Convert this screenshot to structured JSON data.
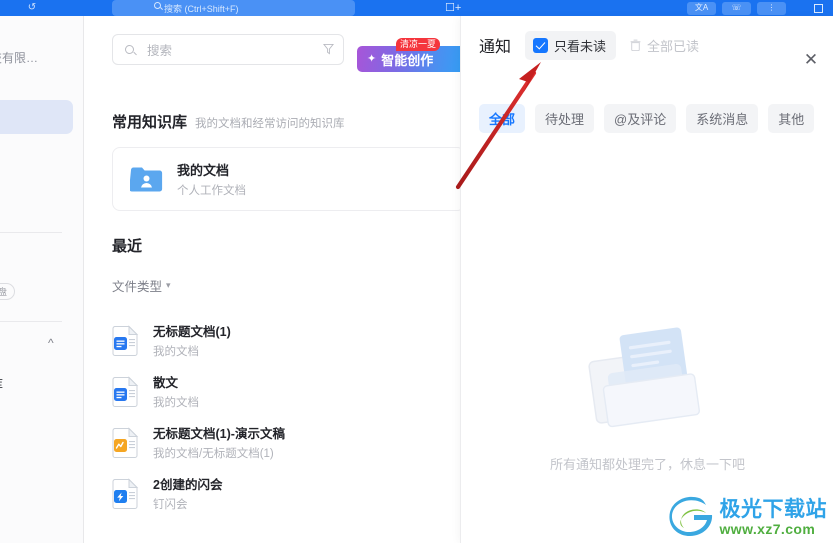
{
  "titlebar": {
    "history_icon": "history-icon",
    "search_placeholder": "搜索 (Ctrl+Shift+F)",
    "new_tab_icon": "new-tab-icon",
    "right_buttons": [
      {
        "icon": "translate-icon",
        "label": "文A"
      },
      {
        "icon": "phone-icon",
        "label": "☏"
      },
      {
        "icon": "more-icon",
        "label": "⋮"
      }
    ],
    "window_control": "restore-icon"
  },
  "sidebar": {
    "org_name": "科技有限…",
    "pill_label": "自钉盘",
    "collapse_icon": "chevron-up-icon",
    "library_label": "库"
  },
  "content": {
    "search": {
      "placeholder": "搜索",
      "search_icon": "search-icon",
      "filter_icon": "filter-icon"
    },
    "ai_button": {
      "icon": "sparkle-icon",
      "label": "智能创作",
      "badge": "清凉一夏"
    },
    "favorites": {
      "title": "常用知识库",
      "subtitle": "我的文档和经常访问的知识库",
      "cards": [
        {
          "icon": "folder-user-icon",
          "name": "我的文档",
          "desc": "个人工作文档"
        }
      ]
    },
    "recent": {
      "title": "最近",
      "filter_label": "文件类型",
      "filter_chevron": "chevron-down-icon",
      "items": [
        {
          "icon": "doc-blue-icon",
          "name": "无标题文档(1)",
          "path": "我的文档"
        },
        {
          "icon": "doc-blue-icon",
          "name": "散文",
          "path": "我的文档"
        },
        {
          "icon": "slide-orange-icon",
          "name": "无标题文档(1)-演示文稿",
          "path": "我的文档/无标题文档(1)"
        },
        {
          "icon": "meeting-blue-icon",
          "name": "2创建的闪会",
          "path": "钉闪会"
        }
      ]
    }
  },
  "notifications": {
    "title": "通知",
    "unread_only": {
      "label": "只看未读",
      "checked": true,
      "checkbox_icon": "checkbox-checked-icon"
    },
    "mark_all_read": {
      "label": "全部已读",
      "icon": "trash-icon",
      "disabled": true
    },
    "close_icon": "close-icon",
    "tabs": [
      {
        "label": "全部",
        "active": true
      },
      {
        "label": "待处理",
        "active": false
      },
      {
        "label": "@及评论",
        "active": false
      },
      {
        "label": "系统消息",
        "active": false
      },
      {
        "label": "其他",
        "active": false
      }
    ],
    "empty_state": {
      "illustration": "empty-inbox-illustration",
      "message": "所有通知都处理完了，休息一下吧"
    }
  },
  "annotation": {
    "arrow_icon": "red-arrow-pointer",
    "color": "#c62020"
  },
  "watermark": {
    "logo_icon": "aurora-logo-icon",
    "name": "极光下载站",
    "url": "www.xz7.com"
  },
  "colors": {
    "titlebar": "#1a72f0",
    "accent": "#1677ff",
    "tab_active_bg": "#e8f1fe",
    "badge_red": "#f5353d"
  }
}
